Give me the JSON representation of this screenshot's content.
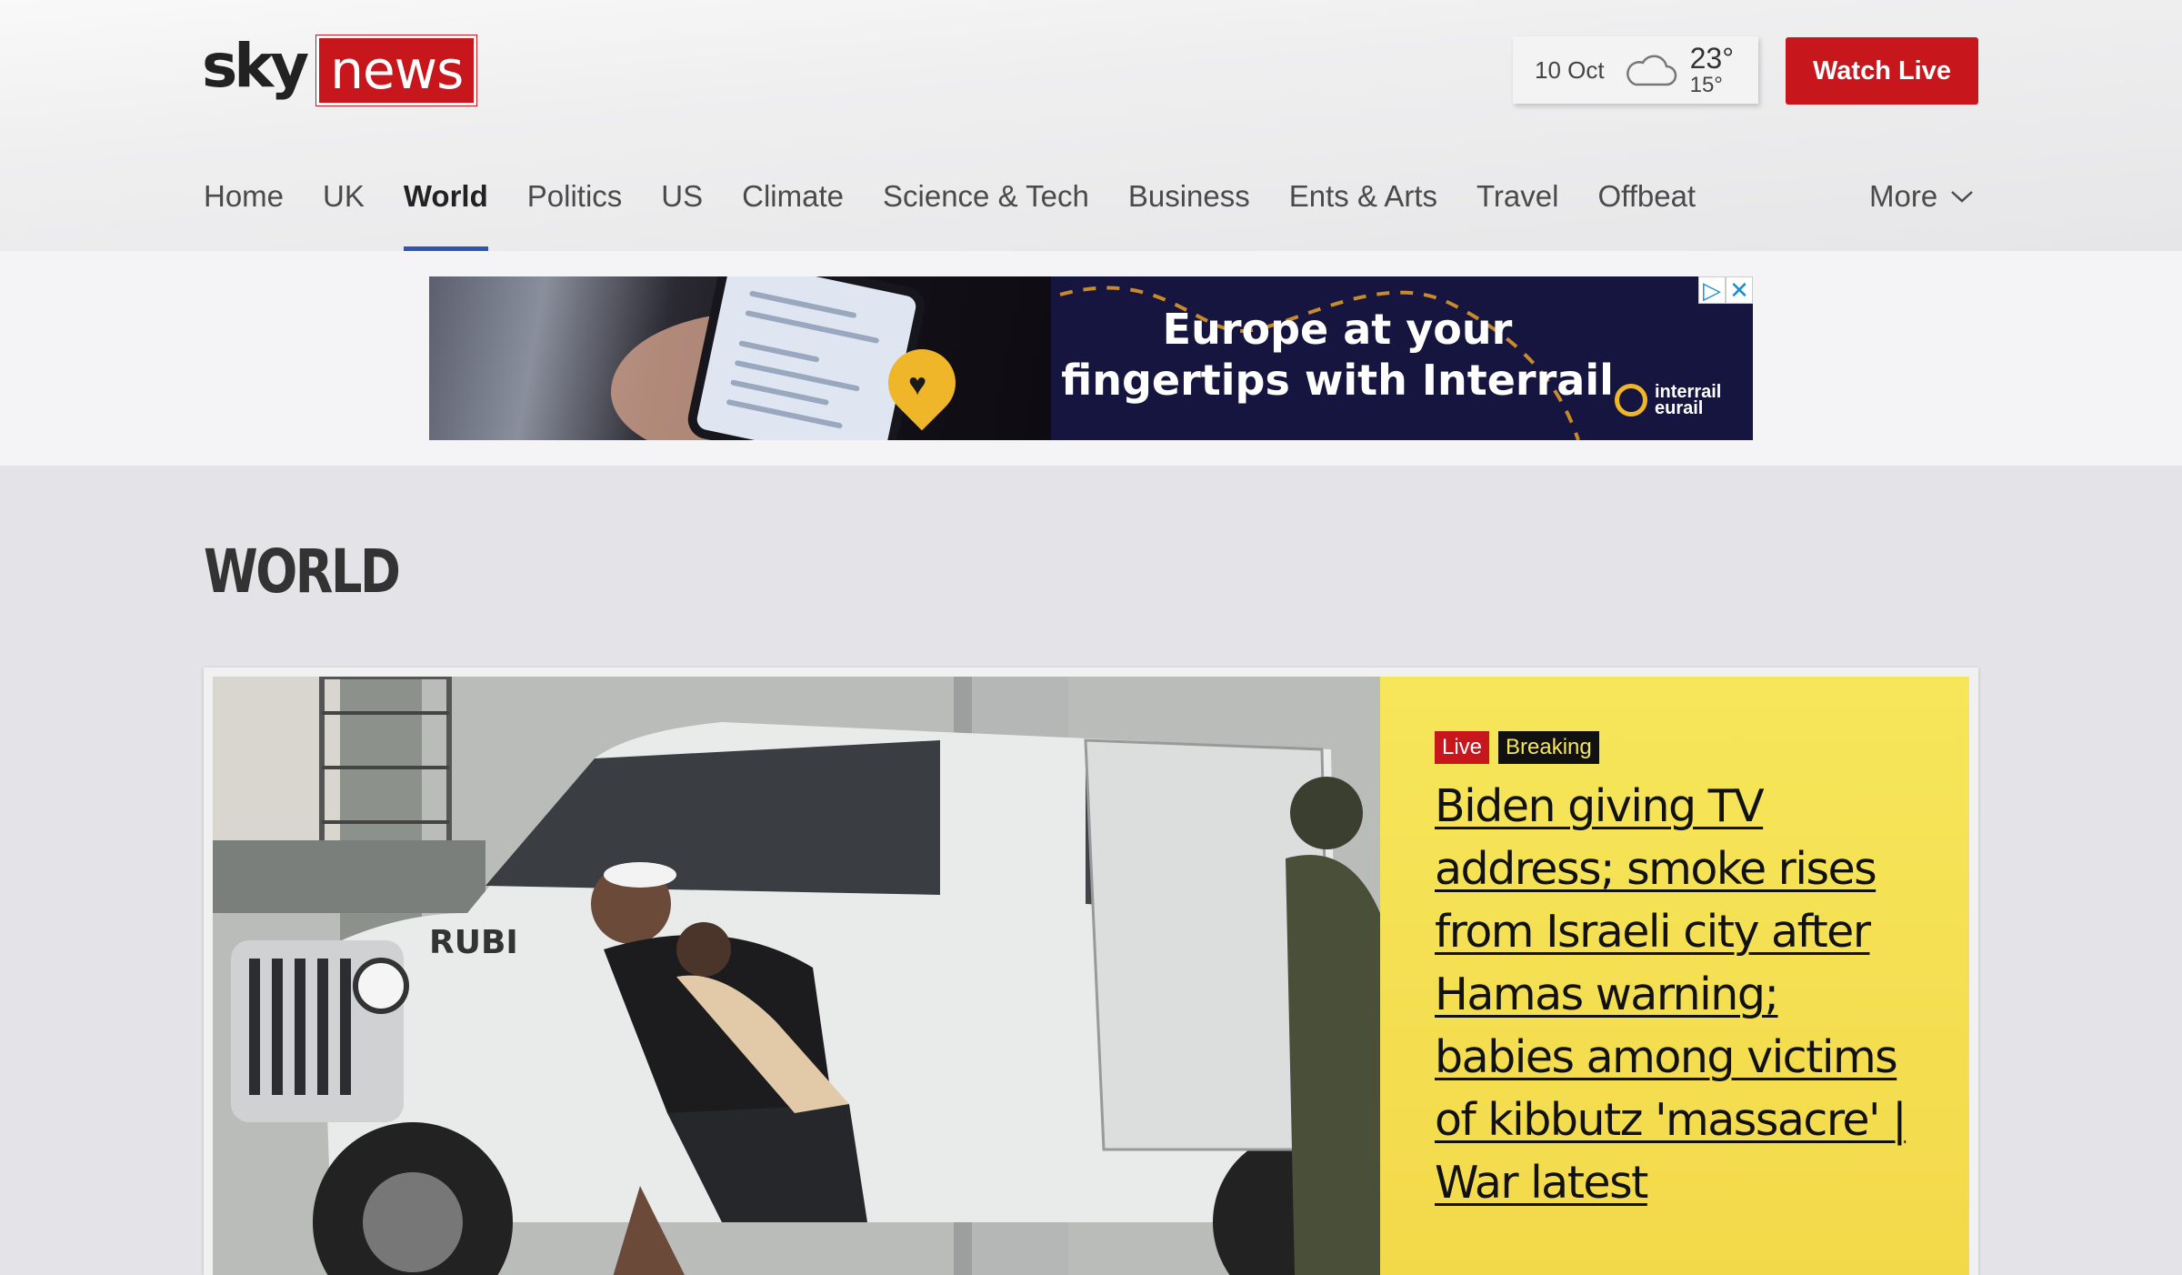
{
  "header": {
    "logo": {
      "sky": "sky",
      "news": "news"
    },
    "weather": {
      "date": "10 Oct",
      "icon": "cloud-icon",
      "high": "23°",
      "low": "15°"
    },
    "watch_live_label": "Watch Live",
    "nav": {
      "items": [
        {
          "label": "Home"
        },
        {
          "label": "UK"
        },
        {
          "label": "World",
          "active": true
        },
        {
          "label": "Politics"
        },
        {
          "label": "US"
        },
        {
          "label": "Climate"
        },
        {
          "label": "Science & Tech"
        },
        {
          "label": "Business"
        },
        {
          "label": "Ents & Arts"
        },
        {
          "label": "Travel"
        },
        {
          "label": "Offbeat"
        }
      ],
      "more_label": "More"
    }
  },
  "ad": {
    "text_line1": "Europe at your",
    "text_line2": "fingertips with Interrail",
    "brand_line1": "interrail",
    "brand_line2": "eurail"
  },
  "main": {
    "section_title": "WORLD",
    "hero": {
      "badge_live": "Live",
      "badge_breaking": "Breaking",
      "headline": "Biden giving TV address; smoke rises from Israeli city after Hamas warning; babies among victims of kibbutz 'massacre' | War latest"
    }
  },
  "colors": {
    "brand_red": "#c8161d",
    "nav_active_underline": "#2e55b5",
    "hero_panel_yellow": "#f7e65a",
    "ad_navy": "#15153f"
  }
}
